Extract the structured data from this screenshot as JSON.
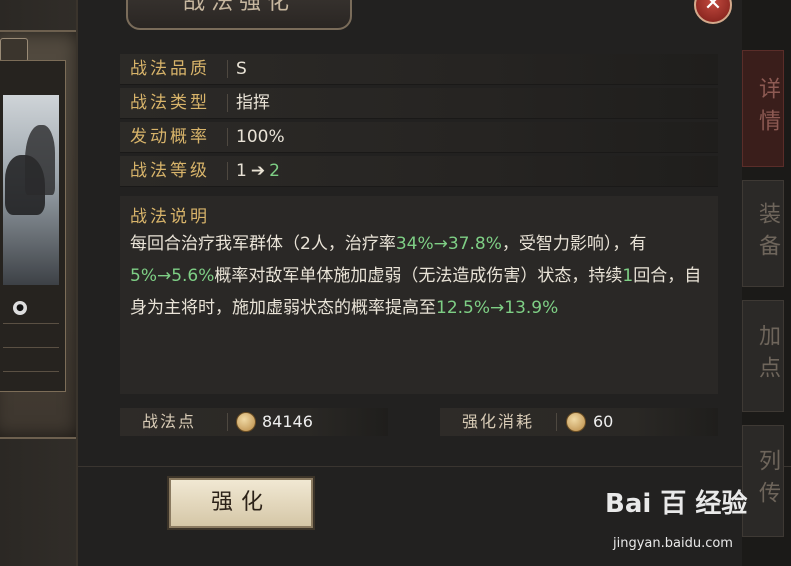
{
  "window": {
    "title": "战法强化",
    "close_icon": "close-icon"
  },
  "card": {
    "icon": "hero-card-icon",
    "badge_icon": "quality-badge-icon",
    "small_icon": "info-icon"
  },
  "info_rows": [
    {
      "label": "战法品质",
      "value": "S"
    },
    {
      "label": "战法类型",
      "value": "指挥"
    },
    {
      "label": "发动概率",
      "value": "100%"
    },
    {
      "label": "战法等级",
      "value_from": "1",
      "arrow": "➔",
      "value_to": "2"
    }
  ],
  "description": {
    "title": "战法说明",
    "segments": [
      {
        "text": "每回合治疗我军群体（2人，治疗率",
        "highlight": false
      },
      {
        "text": "34%→37.8%",
        "highlight": true
      },
      {
        "text": "，受智力影响），有",
        "highlight": false
      },
      {
        "text": "5%→5.6%",
        "highlight": true
      },
      {
        "text": "概率对敌军单体施加虚弱（无法造成伤害）状态，持续",
        "highlight": false
      },
      {
        "text": "1",
        "highlight": true
      },
      {
        "text": "回合，自身为主将时，施加虚弱状态的概率提高至",
        "highlight": false
      },
      {
        "text": "12.5%→13.9%",
        "highlight": true
      }
    ]
  },
  "resources": {
    "points_label": "战法点",
    "points_value": "84146",
    "cost_label": "强化消耗",
    "cost_value": "60",
    "coin_icon": "tactic-point-icon"
  },
  "actions": {
    "enhance_label": "强化"
  },
  "side_tabs": [
    {
      "label": "详情",
      "active": true
    },
    {
      "label": "装备",
      "active": false
    },
    {
      "label": "加点",
      "active": false
    },
    {
      "label": "列传",
      "active": false
    }
  ],
  "watermark": {
    "logo_text": "Bai 百 经验",
    "url": "jingyan.baidu.com"
  },
  "colors": {
    "label_gold": "#d8b46a",
    "highlight_green": "#7ecf85",
    "panel_bg": "#222120",
    "active_tab": "#3a1e1b"
  }
}
